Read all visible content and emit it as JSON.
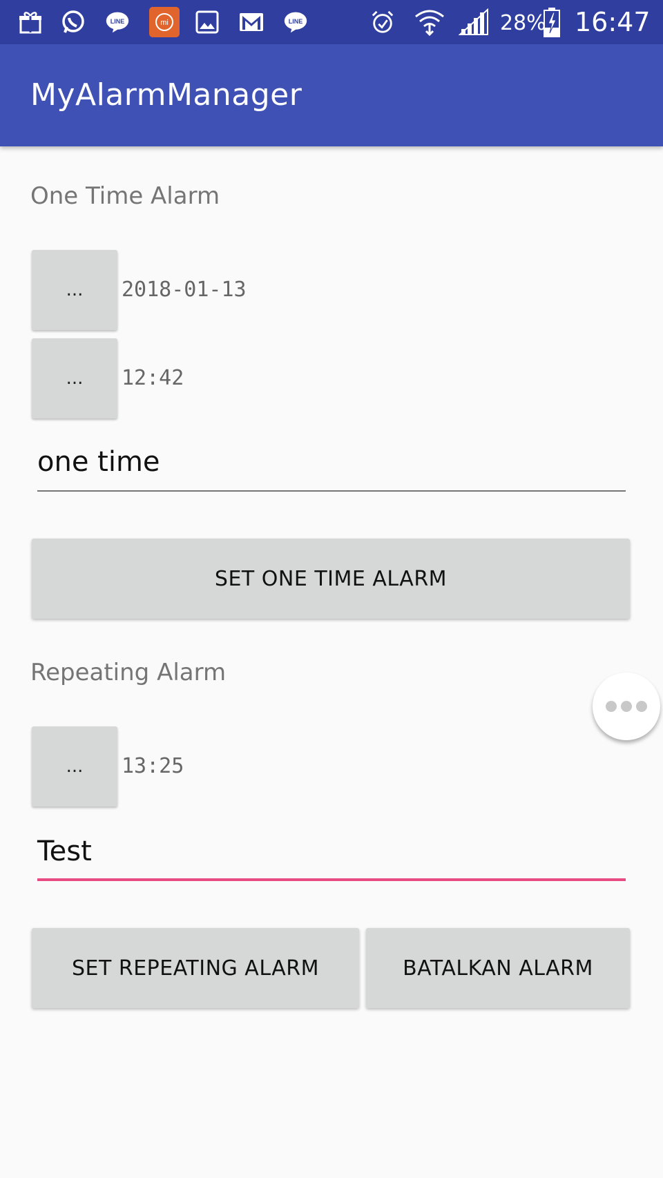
{
  "status_bar": {
    "icons": [
      "gift-icon",
      "whatsapp-icon",
      "line-icon",
      "mi-icon",
      "gallery-icon",
      "gmail-icon",
      "line-icon",
      "alarm-icon",
      "wifi-icon",
      "signal-icon",
      "battery-charging-icon"
    ],
    "battery": "28%",
    "time": "16:47"
  },
  "appbar": {
    "title": "MyAlarmManager"
  },
  "one_time": {
    "title": "One Time Alarm",
    "date_button": "...",
    "date_value": "2018-01-13",
    "time_button": "...",
    "time_value": "12:42",
    "message_value": "one time",
    "set_button": "SET ONE TIME ALARM"
  },
  "repeating": {
    "title": "Repeating Alarm",
    "time_button": "...",
    "time_value": "13:25",
    "message_value": "Test",
    "set_button": "SET REPEATING ALARM",
    "cancel_button": "BATALKAN ALARM"
  },
  "colors": {
    "status_bar": "#303f9f",
    "app_bar": "#3f51b5",
    "accent": "#e84b82",
    "button": "#d6d7d7"
  }
}
